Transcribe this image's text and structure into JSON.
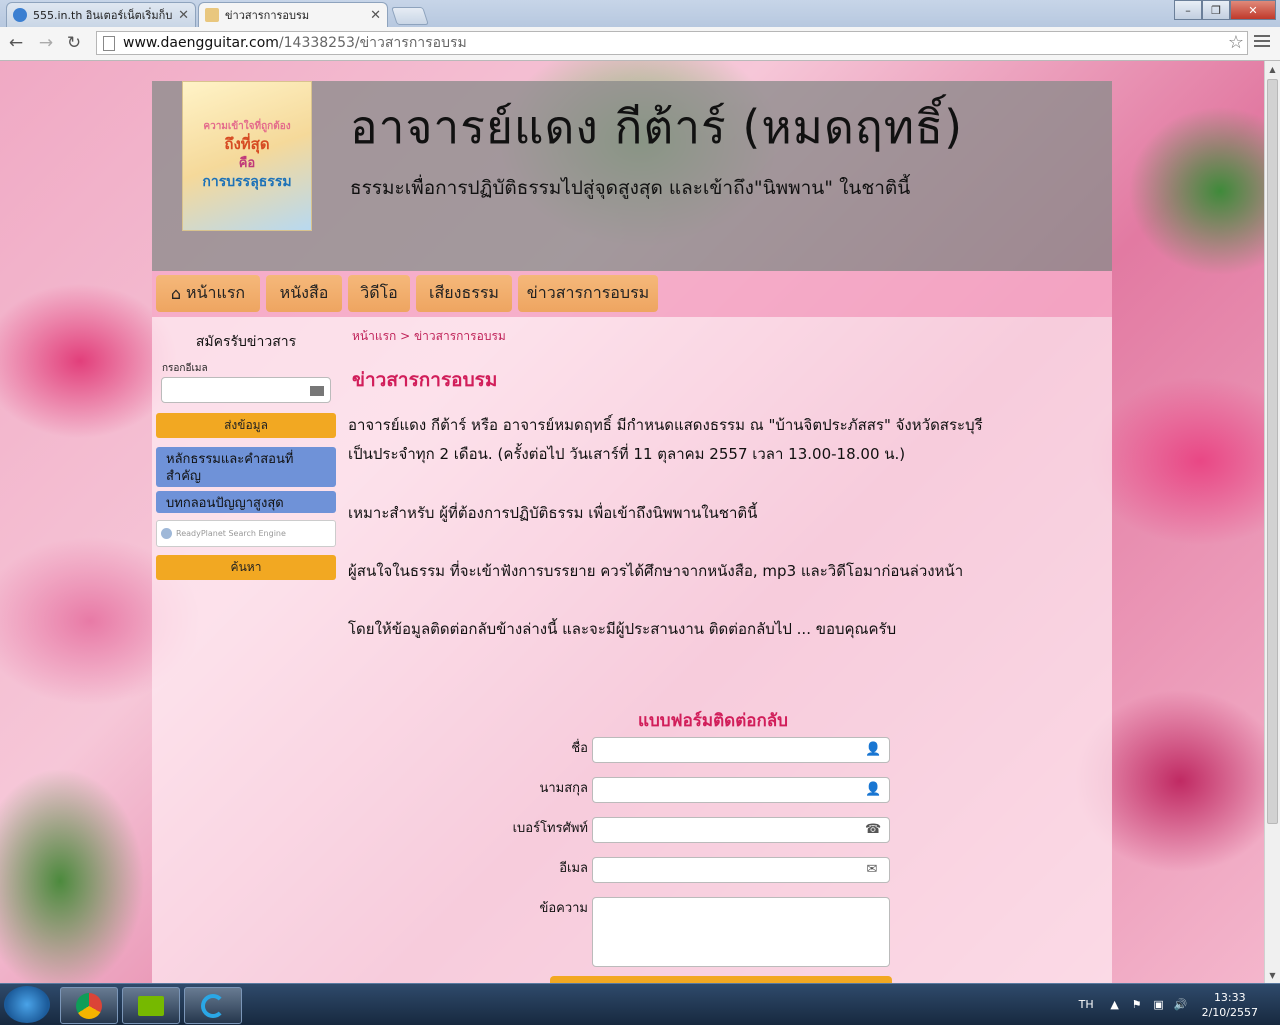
{
  "browser": {
    "tabs": [
      {
        "title": "555.in.th อินเตอร์เน็ตเริ่มก็บ"
      },
      {
        "title": "ข่าวสารการอบรม"
      }
    ],
    "url_domain": "www.daengguitar.com",
    "url_path": "/14338253/ข่าวสารการอบรม",
    "icons": {
      "back": "back-arrow-icon",
      "forward": "forward-arrow-icon",
      "reload": "reload-icon",
      "bookmark": "star-icon",
      "menu": "menu-icon"
    }
  },
  "site": {
    "logo": {
      "line1": "ความเข้าใจที่ถูกต้อง",
      "line2": "ถึงที่สุด",
      "line3": "คือ",
      "line4": "การบรรลุธรรม"
    },
    "title": "อาจารย์แดง กีต้าร์ (หมดฤทธิ์)",
    "subtitle": "ธรรมะเพื่อการปฏิบัติธรรมไปสู่จุดสูงสุด  และเข้าถึง\"นิพพาน\"  ในชาตินี้"
  },
  "nav": {
    "items": [
      {
        "label": "หน้าแรก",
        "icon": "home-icon"
      },
      {
        "label": "หนังสือ"
      },
      {
        "label": "วิดีโอ"
      },
      {
        "label": "เสียงธรรม"
      },
      {
        "label": "ข่าวสารการอบรม"
      }
    ]
  },
  "sidebar": {
    "heading": "สมัครรับข่าวสาร",
    "email_label": "กรอกอีเมล",
    "email_value": "",
    "subscribe_button": "ส่งข้อมูล",
    "links": [
      "หลักธรรมและคำสอนที่สำคัญ",
      "บทกลอนปัญญาสูงสุด"
    ],
    "search_placeholder": "ReadyPlanet Search Engine",
    "search_button": "ค้นหา"
  },
  "main": {
    "breadcrumb": "หน้าแรก > ข่าวสารการอบรม",
    "title": "ข่าวสารการอบรม",
    "paragraphs": [
      "อาจารย์แดง กีต้าร์ หรือ อาจารย์หมดฤทธิ์ มีกำหนดแสดงธรรม ณ \"บ้านจิตประภัสสร\" จังหวัดสระบุรี เป็นประจำทุก 2 เดือน. (ครั้งต่อไป วันเสาร์ที่ 11 ตุลาคม 2557 เวลา 13.00-18.00 น.)",
      "เหมาะสำหรับ ผู้ที่ต้องการปฏิบัติธรรม เพื่อเข้าถึงนิพพานในชาตินี้",
      "ผู้สนใจในธรรม ที่จะเข้าฟังการบรรยาย ควรได้ศึกษาจากหนังสือ, mp3 และวิดีโอมาก่อนล่วงหน้า",
      "โดยให้ข้อมูลติดต่อกลับข้างล่างนี้ และจะมีผู้ประสานงาน ติดต่อกลับไป ... ขอบคุณครับ"
    ],
    "form": {
      "title": "แบบฟอร์มติดต่อกลับ",
      "fields": [
        {
          "label": "ชื่อ",
          "value": "",
          "icon": "user-icon"
        },
        {
          "label": "นามสกุล",
          "value": "",
          "icon": "user-icon"
        },
        {
          "label": "เบอร์โทรศัพท์",
          "value": "",
          "icon": "phone-icon"
        },
        {
          "label": "อีเมล",
          "value": "",
          "icon": "envelope-icon"
        },
        {
          "label": "ข้อความ",
          "value": ""
        }
      ]
    }
  },
  "taskbar": {
    "apps": [
      "chrome-icon",
      "nvidia-icon",
      "app-icon"
    ],
    "language": "TH",
    "time": "13:33",
    "date": "2/10/2557"
  }
}
